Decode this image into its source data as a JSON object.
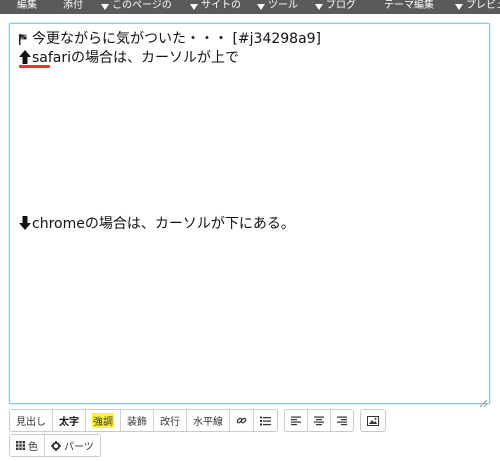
{
  "menubar": {
    "items": [
      {
        "label": "編集",
        "caret": false
      },
      {
        "label": "添付",
        "caret": false
      },
      {
        "label": "このページの",
        "caret": true
      },
      {
        "label": "サイトの",
        "caret": true
      },
      {
        "label": "ツール",
        "caret": true
      },
      {
        "label": "ブログ",
        "caret": true
      },
      {
        "label": "テーマ編集",
        "caret": false
      },
      {
        "label": "プレビュ",
        "caret": true
      }
    ]
  },
  "editor": {
    "line1_text": "今更ながらに気がついた・・・ [#j34298a9]",
    "line2_text": "safariの場合は、カーソルが上で",
    "line3_text": "chromeの場合は、カーソルが下にある。",
    "line1_icon": "flag-icon",
    "line2_icon": "arrow-up-icon",
    "line3_icon": "arrow-down-icon",
    "caret_marker_color": "#e8342f",
    "border_color": "#8fc3e9"
  },
  "toolbar": {
    "heading_label": "見出し",
    "bold_label": "太字",
    "emphasis_label": "強調",
    "decoration_label": "装飾",
    "linebreak_label": "改行",
    "hr_label": "水平線",
    "link_icon": "link-icon",
    "list_icon": "list-icon",
    "align_left_icon": "align-left-icon",
    "align_center_icon": "align-center-icon",
    "align_right_icon": "align-right-icon",
    "image_icon": "image-icon",
    "color_label": "色",
    "color_icon": "grid-icon",
    "parts_label": "パーツ",
    "parts_icon": "gear-icon",
    "emphasis_highlight_color": "#fff23a"
  }
}
